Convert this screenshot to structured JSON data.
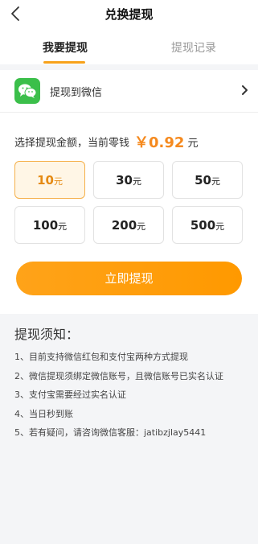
{
  "header": {
    "title": "兑换提现",
    "back_icon": "back-arrow-icon"
  },
  "tabs": [
    {
      "label": "我要提现",
      "active": true
    },
    {
      "label": "提现记录",
      "active": false
    }
  ],
  "accent_color": "#f7a21b",
  "payout_method": {
    "label": "提现到微信",
    "icon": "wechat-icon",
    "icon_color": "#3bbf4a",
    "chevron": "chevron-right-icon"
  },
  "amount": {
    "prompt": "选择提现金额，当前零钱",
    "balance": "￥0.92",
    "balance_unit": "元"
  },
  "options": [
    {
      "value": "10",
      "unit": "元",
      "selected": true
    },
    {
      "value": "30",
      "unit": "元",
      "selected": false
    },
    {
      "value": "50",
      "unit": "元",
      "selected": false
    },
    {
      "value": "100",
      "unit": "元",
      "selected": false
    },
    {
      "value": "200",
      "unit": "元",
      "selected": false
    },
    {
      "value": "500",
      "unit": "元",
      "selected": false
    }
  ],
  "submit_label": "立即提现",
  "notice": {
    "title": "提现须知：",
    "items": [
      "1、目前支持微信红包和支付宝两种方式提现",
      "2、微信提现须绑定微信账号，且微信账号已实名认证",
      "3、支付宝需要经过实名认证",
      "4、当日秒到账",
      "5、若有疑问，请咨询微信客服：jatibzjlay5441"
    ]
  }
}
